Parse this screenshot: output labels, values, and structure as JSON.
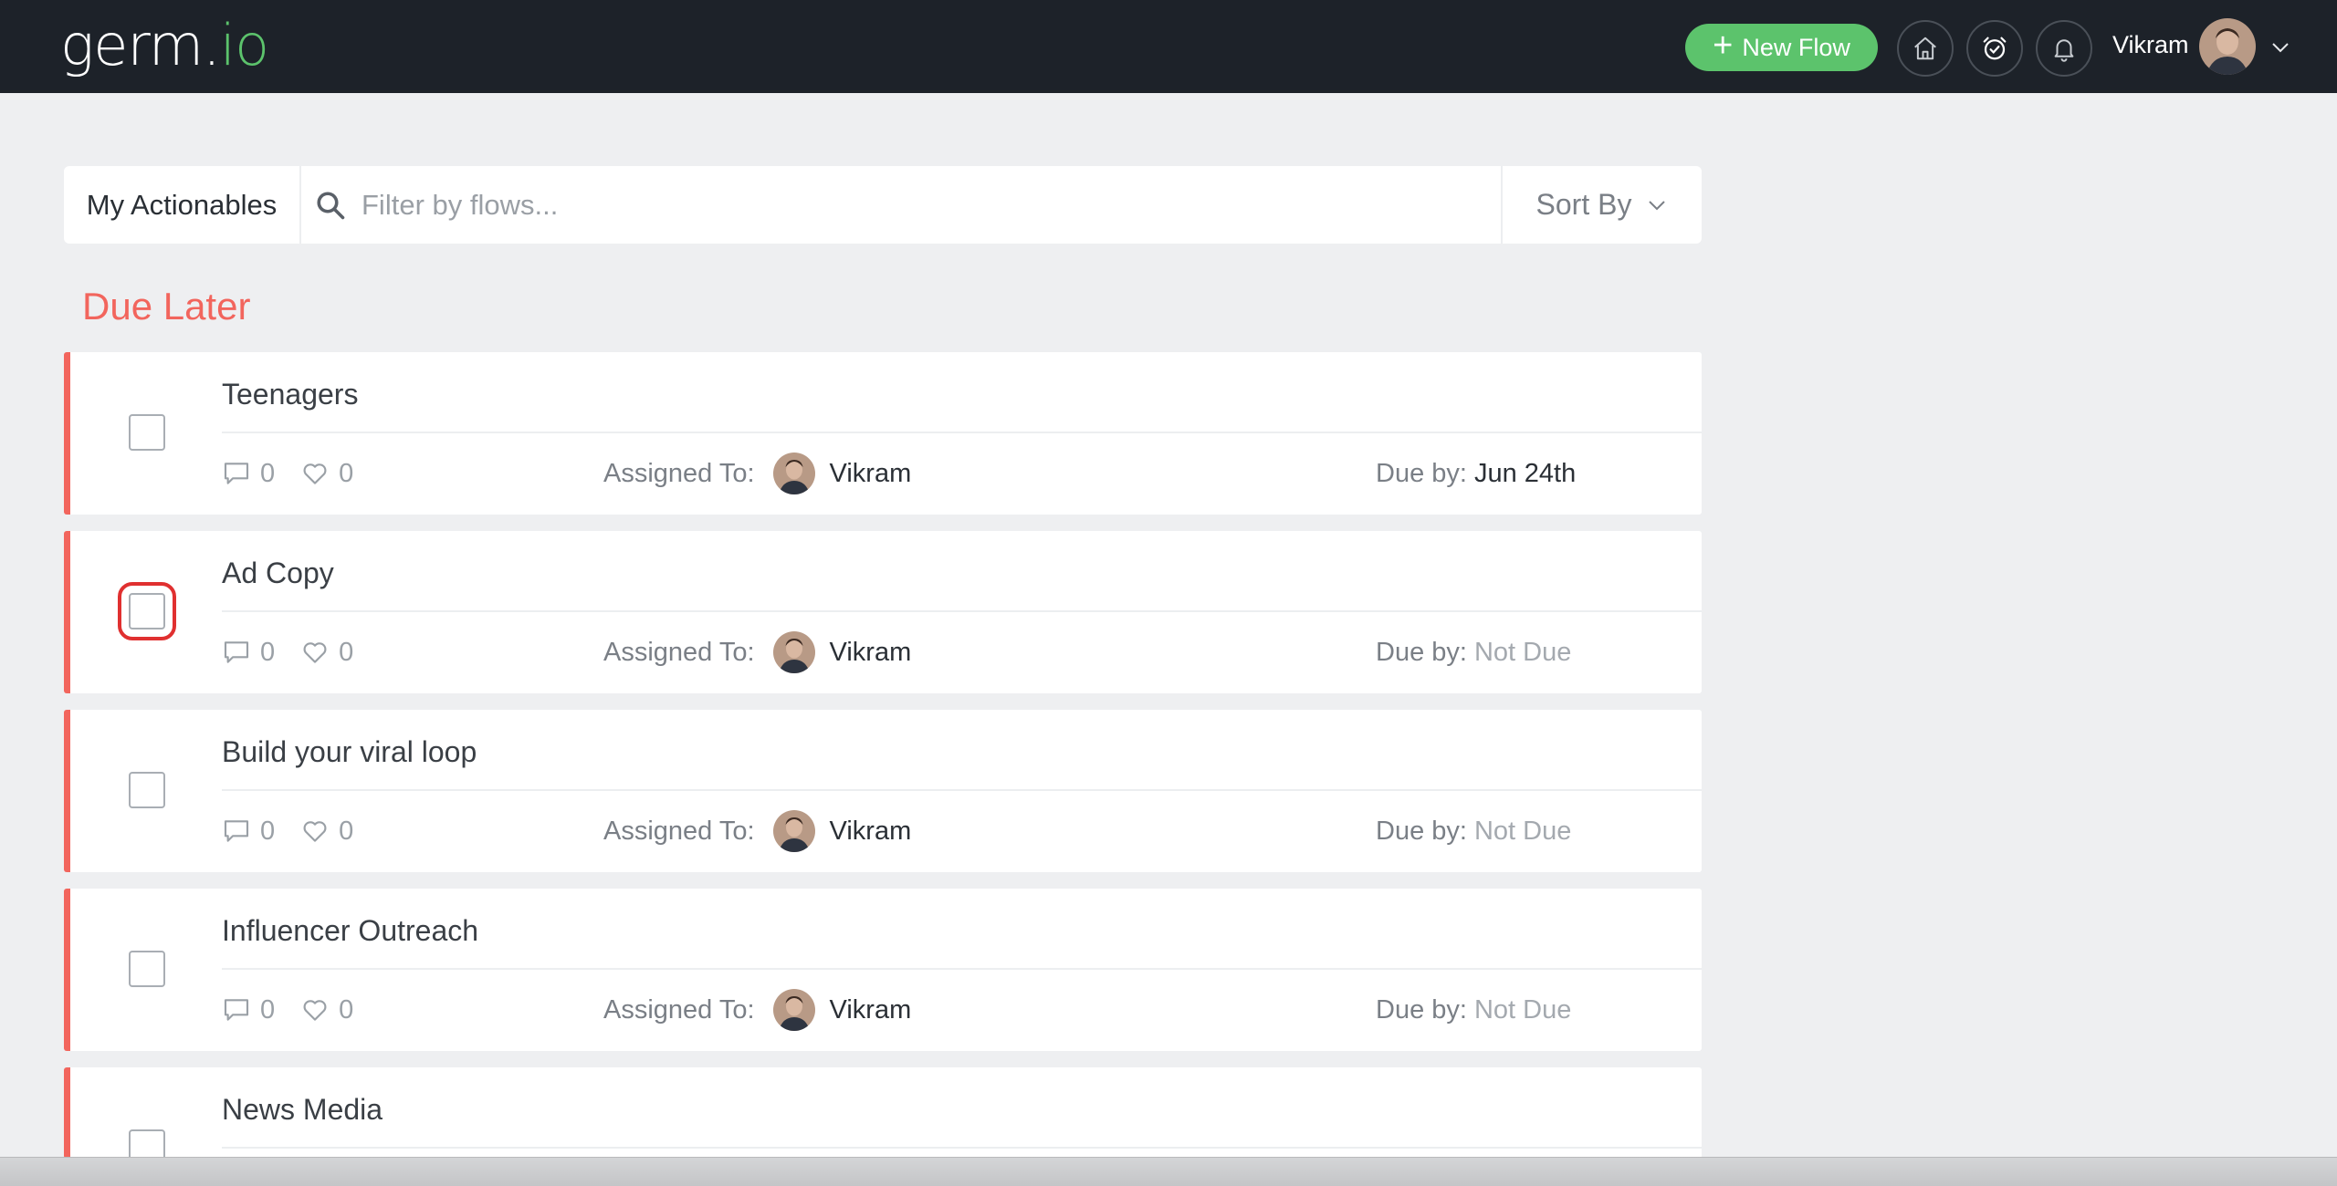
{
  "brand": {
    "logo_main": "germ.",
    "logo_accent": "io",
    "accent_color": "#5cc36c"
  },
  "header": {
    "new_flow_label": "New Flow",
    "icons": [
      "home-icon",
      "alarm-check-icon",
      "bell-icon"
    ],
    "user_name": "Vikram"
  },
  "filter": {
    "tab_label": "My Actionables",
    "search_placeholder": "Filter by flows...",
    "sort_label": "Sort By"
  },
  "section": {
    "title": "Due Later",
    "color": "#f2655d"
  },
  "labels": {
    "assigned_to": "Assigned To:",
    "due_by": "Due by:"
  },
  "tasks": [
    {
      "title": "Teenagers",
      "comments": "0",
      "likes": "0",
      "assignee": "Vikram",
      "due": "Jun 24th",
      "due_status": "dated",
      "highlighted": false
    },
    {
      "title": "Ad Copy",
      "comments": "0",
      "likes": "0",
      "assignee": "Vikram",
      "due": "Not Due",
      "due_status": "not-due",
      "highlighted": true
    },
    {
      "title": "Build your viral loop",
      "comments": "0",
      "likes": "0",
      "assignee": "Vikram",
      "due": "Not Due",
      "due_status": "not-due",
      "highlighted": false
    },
    {
      "title": "Influencer Outreach",
      "comments": "0",
      "likes": "0",
      "assignee": "Vikram",
      "due": "Not Due",
      "due_status": "not-due",
      "highlighted": false
    },
    {
      "title": "News Media"
    }
  ]
}
